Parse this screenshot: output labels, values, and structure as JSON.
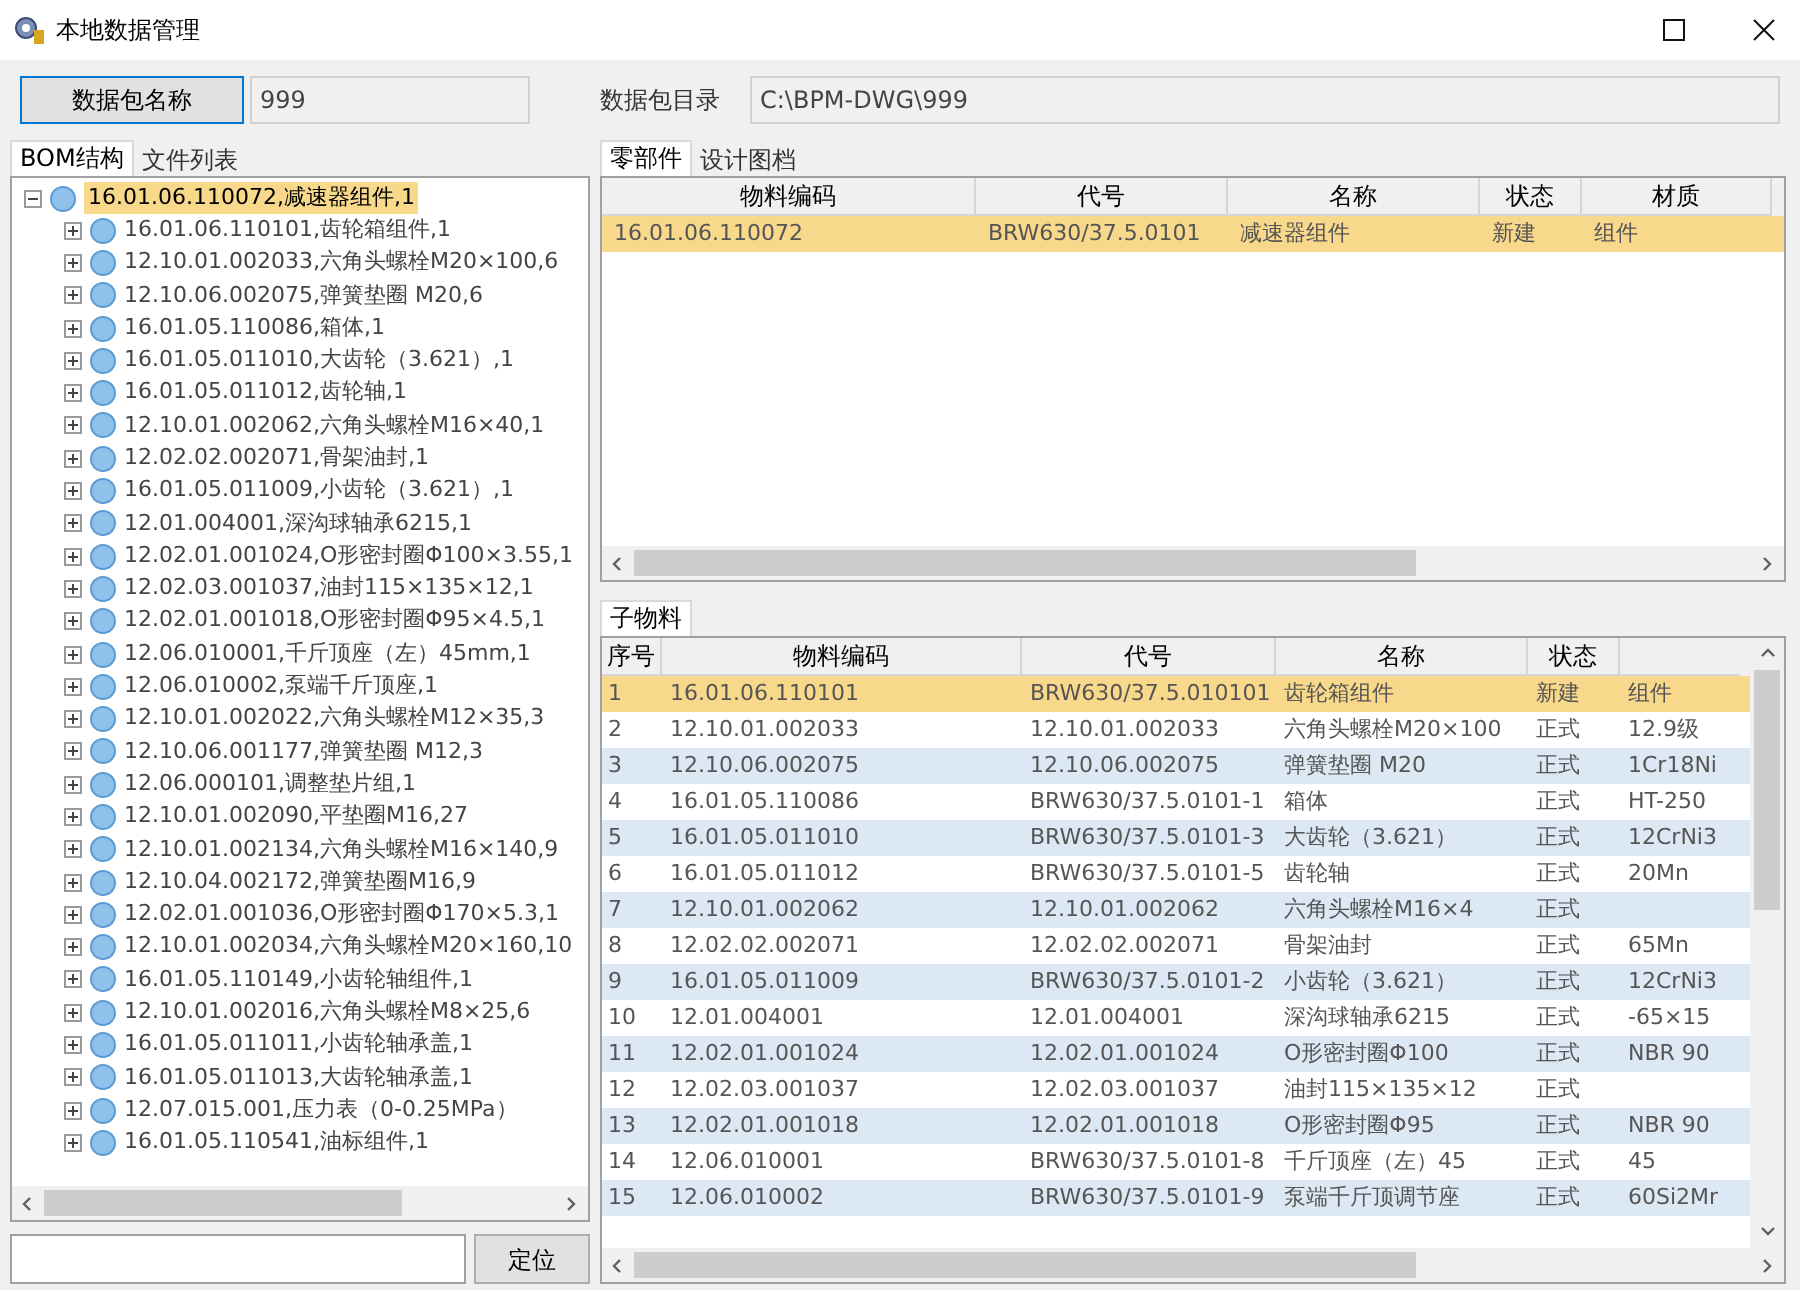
{
  "window": {
    "title": "本地数据管理"
  },
  "package": {
    "name_button": "数据包名称",
    "name_value": "999",
    "dir_label": "数据包目录",
    "dir_value": "C:\\BPM-DWG\\999"
  },
  "left_tabs": [
    {
      "label": "BOM结构",
      "selected": true
    },
    {
      "label": "文件列表",
      "selected": false
    }
  ],
  "tree": {
    "label": "16.01.06.110072,减速器组件,1",
    "selected": true,
    "expanded": true,
    "children": [
      {
        "label": "16.01.06.110101,齿轮箱组件,1",
        "expanded": false
      },
      {
        "label": "12.10.01.002033,六角头螺栓M20×100,6",
        "expanded": false
      },
      {
        "label": "12.10.06.002075,弹簧垫圈 M20,6",
        "expanded": false
      },
      {
        "label": "16.01.05.110086,箱体,1",
        "expanded": false
      },
      {
        "label": "16.01.05.011010,大齿轮（3.621）,1",
        "expanded": false
      },
      {
        "label": "16.01.05.011012,齿轮轴,1",
        "expanded": false
      },
      {
        "label": "12.10.01.002062,六角头螺栓M16×40,1",
        "expanded": false
      },
      {
        "label": "12.02.02.002071,骨架油封,1",
        "expanded": false
      },
      {
        "label": "16.01.05.011009,小齿轮（3.621）,1",
        "expanded": false
      },
      {
        "label": "12.01.004001,深沟球轴承6215,1",
        "expanded": false
      },
      {
        "label": "12.02.01.001024,O形密封圈Φ100×3.55,1",
        "expanded": false
      },
      {
        "label": "12.02.03.001037,油封115×135×12,1",
        "expanded": false
      },
      {
        "label": "12.02.01.001018,O形密封圈Φ95×4.5,1",
        "expanded": false
      },
      {
        "label": "12.06.010001,千斤顶座（左）45mm,1",
        "expanded": false
      },
      {
        "label": "12.06.010002,泵端千斤顶座,1",
        "expanded": false
      },
      {
        "label": "12.10.01.002022,六角头螺栓M12×35,3",
        "expanded": false
      },
      {
        "label": "12.10.06.001177,弹簧垫圈 M12,3",
        "expanded": false
      },
      {
        "label": "12.06.000101,调整垫片组,1",
        "expanded": false
      },
      {
        "label": "12.10.01.002090,平垫圈M16,27",
        "expanded": false
      },
      {
        "label": "12.10.01.002134,六角头螺栓M16×140,9",
        "expanded": false
      },
      {
        "label": "12.10.04.002172,弹簧垫圈M16,9",
        "expanded": false
      },
      {
        "label": "12.02.01.001036,O形密封圈Φ170×5.3,1",
        "expanded": false
      },
      {
        "label": "12.10.01.002034,六角头螺栓M20×160,10",
        "expanded": false
      },
      {
        "label": "16.01.05.110149,小齿轮轴组件,1",
        "expanded": false
      },
      {
        "label": "12.10.01.002016,六角头螺栓M8×25,6",
        "expanded": false
      },
      {
        "label": "16.01.05.011011,小齿轮轴承盖,1",
        "expanded": false
      },
      {
        "label": "16.01.05.011013,大齿轮轴承盖,1",
        "expanded": false
      },
      {
        "label": "12.07.015.001,压力表（0-0.25MPa）",
        "expanded": false
      },
      {
        "label": "16.01.05.110541,油标组件,1",
        "expanded": false
      }
    ]
  },
  "locate": {
    "button": "定位"
  },
  "parts_tabs": [
    {
      "label": "零部件",
      "selected": true
    },
    {
      "label": "设计图档",
      "selected": false
    }
  ],
  "parts_table": {
    "columns": [
      "物料编码",
      "代号",
      "名称",
      "状态",
      "材质"
    ],
    "rows": [
      {
        "selected": true,
        "cells": [
          "16.01.06.110072",
          "BRW630/37.5.0101",
          "减速器组件",
          "新建",
          "组件"
        ]
      }
    ]
  },
  "sub_tabs": [
    {
      "label": "子物料",
      "selected": true
    }
  ],
  "sub_table": {
    "columns": [
      "序号",
      "物料编码",
      "代号",
      "名称",
      "状态"
    ],
    "rows": [
      {
        "selected": true,
        "cells": [
          "1",
          "16.01.06.110101",
          "BRW630/37.5.010101",
          "齿轮箱组件",
          "新建",
          "组件"
        ]
      },
      {
        "selected": false,
        "cells": [
          "2",
          "12.10.01.002033",
          "12.10.01.002033",
          "六角头螺栓M20×100",
          "正式",
          "12.9级"
        ]
      },
      {
        "selected": false,
        "cells": [
          "3",
          "12.10.06.002075",
          "12.10.06.002075",
          "弹簧垫圈 M20",
          "正式",
          "1Cr18Ni"
        ]
      },
      {
        "selected": false,
        "cells": [
          "4",
          "16.01.05.110086",
          "BRW630/37.5.0101-1",
          "箱体",
          "正式",
          "HT-250"
        ]
      },
      {
        "selected": false,
        "cells": [
          "5",
          "16.01.05.011010",
          "BRW630/37.5.0101-3",
          "大齿轮（3.621）",
          "正式",
          "12CrNi3"
        ]
      },
      {
        "selected": false,
        "cells": [
          "6",
          "16.01.05.011012",
          "BRW630/37.5.0101-5",
          "齿轮轴",
          "正式",
          "20Mn"
        ]
      },
      {
        "selected": false,
        "cells": [
          "7",
          "12.10.01.002062",
          "12.10.01.002062",
          "六角头螺栓M16×4",
          "正式"
        ]
      },
      {
        "selected": false,
        "cells": [
          "8",
          "12.02.02.002071",
          "12.02.02.002071",
          "骨架油封",
          "正式",
          "65Mn"
        ]
      },
      {
        "selected": false,
        "cells": [
          "9",
          "16.01.05.011009",
          "BRW630/37.5.0101-2",
          "小齿轮（3.621）",
          "正式",
          "12CrNi3"
        ]
      },
      {
        "selected": false,
        "cells": [
          "10",
          "12.01.004001",
          "12.01.004001",
          "深沟球轴承6215",
          "正式",
          "-65×15"
        ]
      },
      {
        "selected": false,
        "cells": [
          "11",
          "12.02.01.001024",
          "12.02.01.001024",
          "O形密封圈Φ100",
          "正式",
          "NBR 90"
        ]
      },
      {
        "selected": false,
        "cells": [
          "12",
          "12.02.03.001037",
          "12.02.03.001037",
          "油封115×135×12",
          "正式"
        ]
      },
      {
        "selected": false,
        "cells": [
          "13",
          "12.02.01.001018",
          "12.02.01.001018",
          "O形密封圈Φ95",
          "正式",
          "NBR 90"
        ]
      },
      {
        "selected": false,
        "cells": [
          "14",
          "12.06.010001",
          "BRW630/37.5.0101-8",
          "千斤顶座（左）45",
          "正式",
          "45"
        ]
      },
      {
        "selected": false,
        "cells": [
          "15",
          "12.06.010002",
          "BRW630/37.5.0101-9",
          "泵端千斤顶调节座",
          "正式",
          "60Si2Mr"
        ]
      }
    ]
  }
}
